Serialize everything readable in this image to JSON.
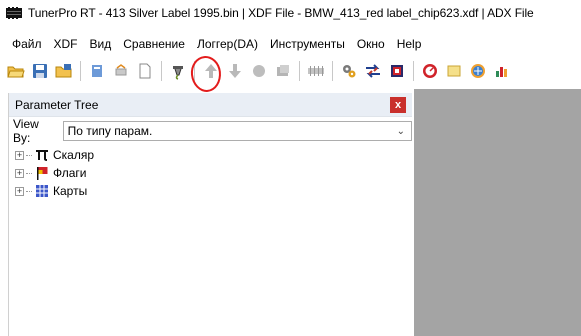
{
  "window": {
    "title": "TunerPro RT - 413 Silver Label 1995.bin | XDF File - BMW_413_red label_chip623.xdf | ADX File"
  },
  "menu": {
    "items": [
      "Файл",
      "XDF",
      "Вид",
      "Сравнение",
      "Логгер(DA)",
      "Инструменты",
      "Окно",
      "Help"
    ]
  },
  "toolbar": {
    "icons": [
      "open-folder-icon",
      "save-icon",
      "open-xdf-icon",
      "edit-icon",
      "chip-icon",
      "new-document-icon",
      "emulator-plug-icon",
      "upload-arrow-icon",
      "download-arrow-icon",
      "record-icon",
      "device-icon",
      "memory-chip-icon",
      "settings-gears-icon",
      "compare-arrows-icon",
      "stop-datalog-icon",
      "gauge-icon",
      "folder-yellow-icon",
      "globe-icon",
      "bar-chart-icon"
    ],
    "highlight_color": "#e31c1c"
  },
  "panel": {
    "title": "Parameter Tree",
    "close_label": "x",
    "view_by_label": "View By:",
    "view_by_value": "По типу парам.",
    "tree": [
      {
        "label": "Скаляр",
        "icon": "pi-icon"
      },
      {
        "label": "Флаги",
        "icon": "flag-icon"
      },
      {
        "label": "Карты",
        "icon": "table-grid-icon"
      }
    ]
  },
  "colors": {
    "workspace": "#a4a4a4",
    "panel_header": "#e9eef5",
    "close_button": "#c9302c"
  }
}
